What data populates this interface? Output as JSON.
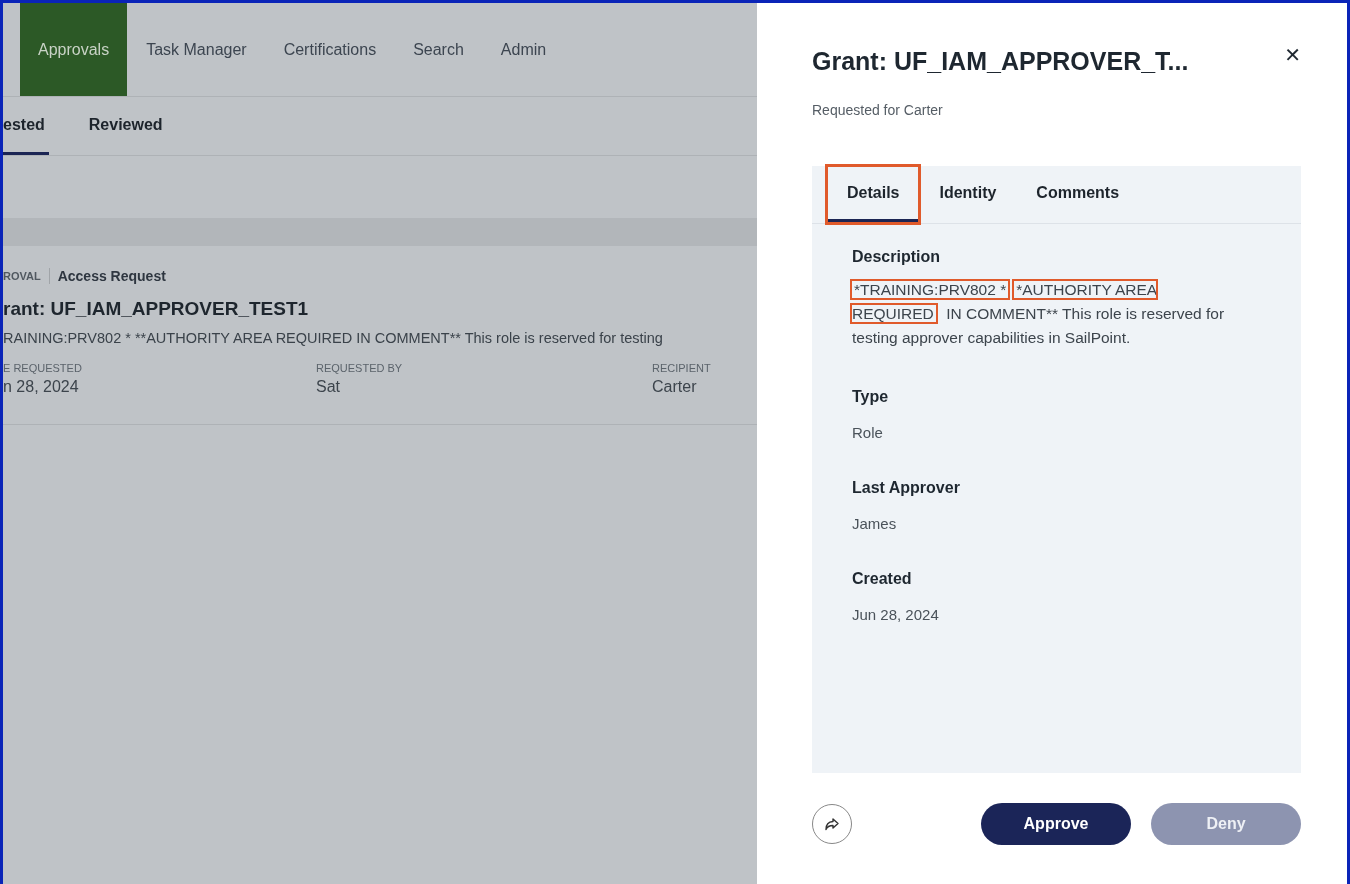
{
  "nav": [
    {
      "label": "Approvals",
      "selected": true
    },
    {
      "label": "Task Manager",
      "selected": false
    },
    {
      "label": "Certifications",
      "selected": false
    },
    {
      "label": "Search",
      "selected": false
    },
    {
      "label": "Admin",
      "selected": false
    }
  ],
  "subtabs": [
    {
      "label": "ested",
      "selected": true
    },
    {
      "label": "Reviewed",
      "selected": false
    }
  ],
  "request_card": {
    "category": "ROVAL",
    "type": "Access Request",
    "title": "rant: UF_IAM_APPROVER_TEST1",
    "description": "RAINING:PRV802 * **AUTHORITY AREA REQUIRED IN COMMENT** This role is reserved for testing",
    "fields": [
      {
        "label": "E REQUESTED",
        "value": "n 28, 2024"
      },
      {
        "label": "REQUESTED BY",
        "value": "Sat"
      },
      {
        "label": "RECIPIENT",
        "value": "Carter"
      }
    ]
  },
  "panel": {
    "title": "Grant: UF_IAM_APPROVER_T...",
    "close": "✕",
    "subtitle": "Requested for Carter",
    "tabs": [
      {
        "label": "Details",
        "selected": true,
        "highlighted": true
      },
      {
        "label": "Identity",
        "selected": false,
        "highlighted": false
      },
      {
        "label": "Comments",
        "selected": false,
        "highlighted": false
      }
    ],
    "description_label": "Description",
    "description": [
      {
        "text": "*TRAINING:PRV802 *",
        "highlighted": true
      },
      {
        "text": "*AUTHORITY AREA REQUIRED",
        "highlighted": true
      },
      {
        "text": " IN COMMENT** This role is reserved for testing approver capabilities in SailPoint.",
        "highlighted": false
      }
    ],
    "details": [
      {
        "label": "Type",
        "value": "Role"
      },
      {
        "label": "Last Approver",
        "value": "James"
      },
      {
        "label": "Created",
        "value": "Jun 28, 2024"
      }
    ],
    "buttons": [
      {
        "label": "Approve",
        "kind": "primary"
      },
      {
        "label": "Deny",
        "kind": "secondary"
      }
    ]
  }
}
